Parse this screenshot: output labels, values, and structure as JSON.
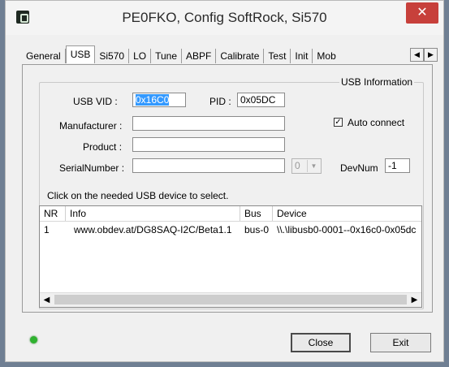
{
  "window": {
    "title": "PE0FKO, Config SoftRock, Si570",
    "close_glyph": "✕"
  },
  "tabs": [
    {
      "label": "General",
      "active": false
    },
    {
      "label": "USB",
      "active": true
    },
    {
      "label": "Si570",
      "active": false
    },
    {
      "label": "LO",
      "active": false
    },
    {
      "label": "Tune",
      "active": false
    },
    {
      "label": "ABPF",
      "active": false
    },
    {
      "label": "Calibrate",
      "active": false
    },
    {
      "label": "Test",
      "active": false
    },
    {
      "label": "Init",
      "active": false
    },
    {
      "label": "Mob",
      "active": false
    }
  ],
  "tab_scroll": {
    "left": "◀",
    "right": "▶"
  },
  "usb": {
    "group_title": "USB Information",
    "vid_label": "USB VID :",
    "vid_value": "0x16C0",
    "pid_label": "PID :",
    "pid_value": "0x05DC",
    "manufacturer_label": "Manufacturer :",
    "manufacturer_value": "",
    "product_label": "Product :",
    "product_value": "",
    "serial_label": "SerialNumber :",
    "serial_value": "",
    "serial_index_value": "0",
    "auto_connect_label": "Auto connect",
    "auto_connect_checked": true,
    "devnum_label": "DevNum",
    "devnum_value": "-1",
    "hint": "Click on the needed USB device to select."
  },
  "device_list": {
    "columns": [
      "NR",
      "Info",
      "Bus",
      "Device"
    ],
    "rows": [
      [
        "1",
        "www.obdev.at/DG8SAQ-I2C/Beta1.1",
        "bus-0",
        "\\\\.\\libusb0-0001--0x16c0-0x05dc"
      ]
    ]
  },
  "buttons": {
    "close": "Close",
    "exit": "Exit"
  },
  "status": {
    "led_color": "#2fb22f"
  }
}
